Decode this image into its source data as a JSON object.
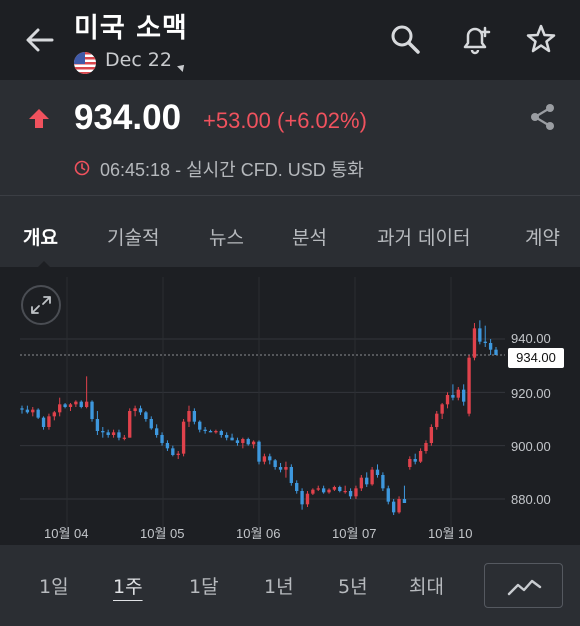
{
  "header": {
    "title": "미국 소맥",
    "contract": "Dec 22",
    "back_icon": "arrow-left-icon",
    "search_icon": "search-icon",
    "alert_icon": "bell-plus-icon",
    "watchlist_icon": "star-icon"
  },
  "quote": {
    "price": "934.00",
    "change": "+53.00 (+6.02%)",
    "time_info": "06:45:18 - 실시간 CFD. USD 통화",
    "direction": "up",
    "colors": {
      "up": "#f0525e",
      "down": "#2f8fe0"
    }
  },
  "tabs": [
    {
      "label": "개요",
      "active": true
    },
    {
      "label": "기술적",
      "active": false
    },
    {
      "label": "뉴스",
      "active": false
    },
    {
      "label": "분석",
      "active": false
    },
    {
      "label": "과거 데이터",
      "active": false
    },
    {
      "label": "계약",
      "active": false
    }
  ],
  "chart": {
    "current_price_label": "934.00",
    "y_ticks": [
      "940.00",
      "920.00",
      "900.00",
      "880.00"
    ],
    "x_ticks": [
      "10월 04",
      "10월 05",
      "10월 06",
      "10월 07",
      "10월 10"
    ]
  },
  "chart_data": {
    "type": "candlestick",
    "ylim": [
      872,
      950
    ],
    "y_ticks": [
      880,
      900,
      920,
      940
    ],
    "x_ticks": [
      "10월 04",
      "10월 05",
      "10월 06",
      "10월 07",
      "10월 10"
    ],
    "last_price": 934.0,
    "colors": {
      "up": "#e0424c",
      "down": "#3e98de"
    },
    "candles": [
      [
        914,
        915,
        912,
        913.5
      ],
      [
        913.5,
        915,
        912,
        912.5
      ],
      [
        912.5,
        914.5,
        911,
        913.5
      ],
      [
        913.5,
        914,
        910,
        910.5
      ],
      [
        910.5,
        911,
        906,
        907
      ],
      [
        907,
        912,
        906,
        911
      ],
      [
        911,
        913,
        909.5,
        912.5
      ],
      [
        912.5,
        918,
        911,
        915.5
      ],
      [
        915.5,
        916,
        914,
        914.5
      ],
      [
        914.5,
        916,
        913,
        915.5
      ],
      [
        915.5,
        917,
        914.5,
        916.5
      ],
      [
        916.5,
        917,
        914,
        914.5
      ],
      [
        914.5,
        926,
        914,
        916.5
      ],
      [
        916.5,
        917,
        909,
        910
      ],
      [
        910,
        913,
        904,
        905.5
      ],
      [
        905.5,
        907,
        903,
        905
      ],
      [
        905,
        906,
        903,
        904
      ],
      [
        904,
        906,
        903,
        905
      ],
      [
        905,
        906,
        902,
        903
      ],
      [
        903,
        904,
        902,
        903
      ],
      [
        903,
        914,
        903,
        913
      ],
      [
        913,
        915,
        911,
        914
      ],
      [
        914,
        915,
        911.5,
        912.5
      ],
      [
        912.5,
        913,
        909,
        910
      ],
      [
        910,
        911,
        906,
        906.5
      ],
      [
        906.5,
        908,
        903,
        904
      ],
      [
        904,
        905,
        900,
        901
      ],
      [
        901,
        902,
        898,
        899
      ],
      [
        899,
        900,
        896,
        896.5
      ],
      [
        896.5,
        898,
        895,
        897
      ],
      [
        897,
        910,
        896,
        909
      ],
      [
        909,
        915,
        907,
        913
      ],
      [
        913,
        914,
        908,
        909
      ],
      [
        909,
        909.5,
        905,
        906
      ],
      [
        906,
        907,
        904.5,
        905.5
      ],
      [
        905.5,
        906,
        905,
        905
      ],
      [
        905,
        906,
        904.5,
        905.5
      ],
      [
        905.5,
        906,
        903,
        904
      ],
      [
        904,
        905,
        902,
        903
      ],
      [
        903,
        904.5,
        902,
        902
      ],
      [
        902,
        903,
        900,
        901
      ],
      [
        901,
        903,
        899,
        902.5
      ],
      [
        902.5,
        903,
        900,
        900.5
      ],
      [
        900.5,
        902,
        899,
        901.5
      ],
      [
        901.5,
        902,
        893,
        894
      ],
      [
        894,
        897,
        893,
        896
      ],
      [
        896,
        897,
        893,
        894.5
      ],
      [
        894.5,
        895,
        891,
        892
      ],
      [
        892,
        893.5,
        890,
        891
      ],
      [
        891,
        894,
        888,
        892
      ],
      [
        892,
        893,
        885,
        886
      ],
      [
        886,
        887,
        882,
        883
      ],
      [
        883,
        884,
        876,
        878
      ],
      [
        878,
        883,
        877,
        882
      ],
      [
        882,
        884,
        881.5,
        883.5
      ],
      [
        883.5,
        885,
        883,
        884
      ],
      [
        884,
        885,
        882,
        882.5
      ],
      [
        882.5,
        884,
        882,
        883.5
      ],
      [
        883.5,
        885,
        883,
        884.5
      ],
      [
        884.5,
        885,
        882.5,
        883
      ],
      [
        883,
        885,
        882,
        883
      ],
      [
        883,
        884,
        880,
        881
      ],
      [
        881,
        885,
        880,
        884
      ],
      [
        884,
        889,
        883,
        888
      ],
      [
        888,
        890,
        884.5,
        885.5
      ],
      [
        885.5,
        892,
        885,
        891
      ],
      [
        891,
        893,
        888,
        889
      ],
      [
        889,
        890,
        883,
        884
      ],
      [
        884,
        885,
        878,
        879
      ],
      [
        879,
        880,
        874,
        875
      ],
      [
        875,
        881,
        874.5,
        880
      ],
      [
        880,
        885,
        879,
        878.5
      ],
      [
        892,
        896,
        891,
        895
      ],
      [
        895,
        897,
        893,
        894
      ],
      [
        894,
        899,
        893.5,
        898
      ],
      [
        898,
        902,
        897,
        901
      ],
      [
        901,
        908,
        900,
        907
      ],
      [
        907,
        913,
        906,
        912
      ],
      [
        912,
        916,
        910,
        915.5
      ],
      [
        915.5,
        920,
        914,
        919
      ],
      [
        919,
        923,
        917,
        918
      ],
      [
        918,
        922,
        917,
        921
      ],
      [
        921,
        923,
        915,
        916.5
      ],
      [
        912,
        934,
        911,
        933
      ],
      [
        933,
        946,
        932,
        944
      ],
      [
        944,
        947,
        938,
        939
      ],
      [
        939,
        945,
        937,
        938.5
      ],
      [
        938.5,
        940,
        934,
        936
      ],
      [
        936,
        937,
        934,
        934
      ]
    ]
  }
}
